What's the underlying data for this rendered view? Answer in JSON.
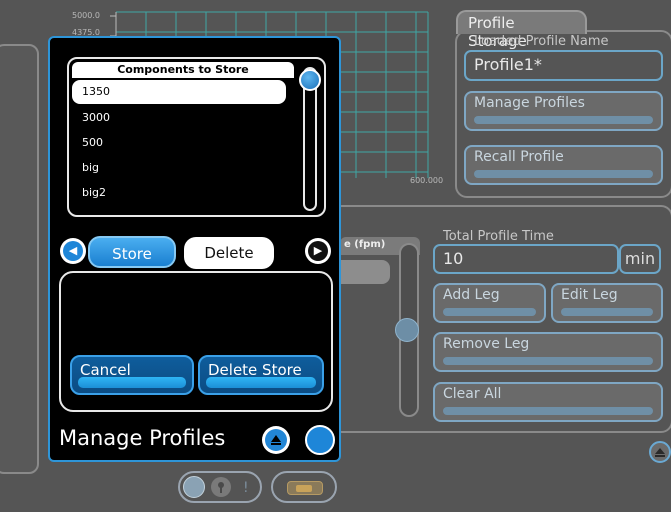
{
  "chart": {
    "y_ticks": [
      "5000.0",
      "4375.0"
    ],
    "x_tick": "600.000"
  },
  "profile_storage": {
    "title": "Profile Storage",
    "loaded_label": "Loaded Profile Name",
    "loaded_value": "Profile1*",
    "manage_label": "Manage Profiles",
    "recall_label": "Recall Profile"
  },
  "profile_legs": {
    "speed_label_partial": "e (fpm)",
    "total_time_label": "Total Profile Time",
    "total_time_value": "10",
    "total_time_unit": "min",
    "add_leg": "Add Leg",
    "edit_leg": "Edit Leg",
    "remove_leg": "Remove Leg",
    "clear_all": "Clear All"
  },
  "modal": {
    "list_header": "Components to Store",
    "items": [
      {
        "label": "1350",
        "selected": true
      },
      {
        "label": "3000",
        "selected": false
      },
      {
        "label": "500",
        "selected": false
      },
      {
        "label": "big",
        "selected": false
      },
      {
        "label": "big2",
        "selected": false
      }
    ],
    "tab_store": "Store",
    "tab_delete": "Delete",
    "cancel": "Cancel",
    "delete_store": "Delete Store",
    "title": "Manage Profiles"
  },
  "icons": {
    "prev": "chevron-left-icon",
    "next": "chevron-right-icon",
    "collapse": "collapse-up-icon"
  },
  "colors": {
    "accent": "#1e86d8",
    "modal_border": "#2e95d8",
    "background": "#555555"
  }
}
